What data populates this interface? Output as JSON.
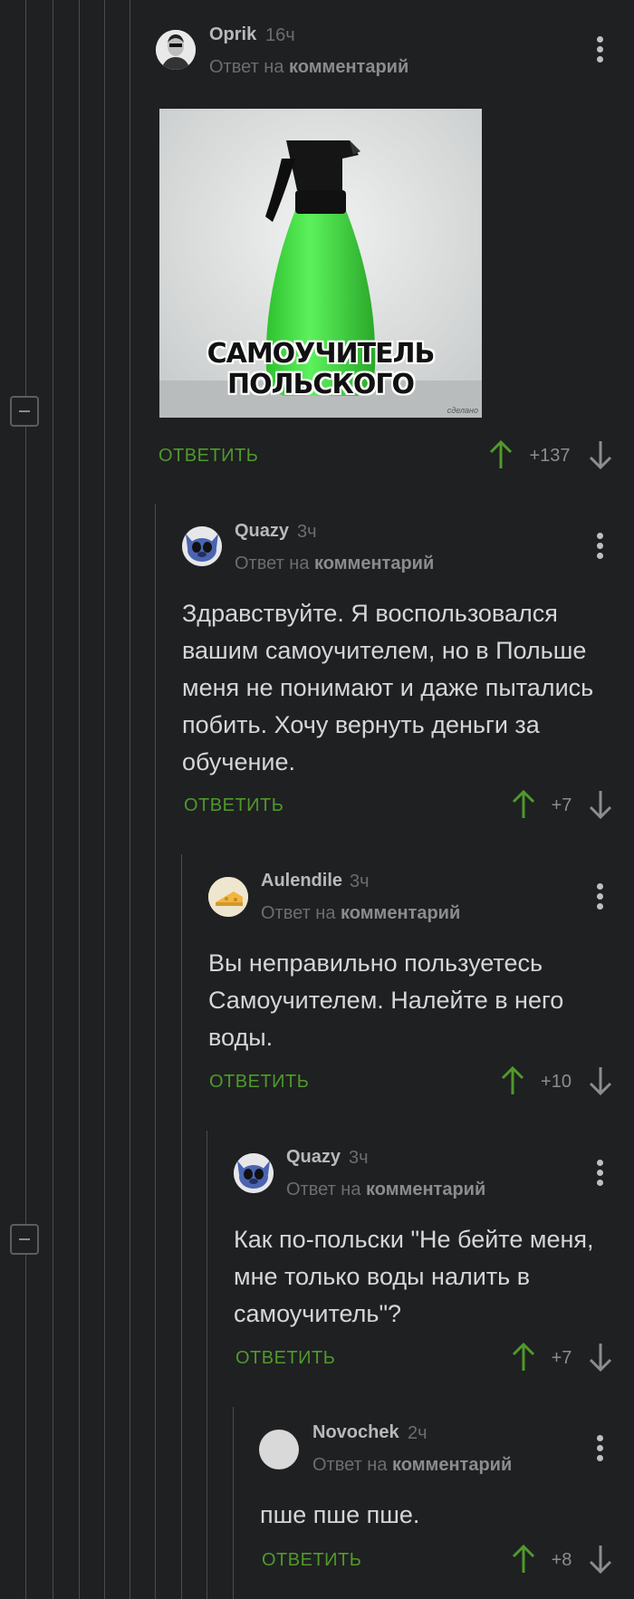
{
  "reply_prefix": "Ответ на",
  "reply_target": "комментарий",
  "reply_label": "ОТВЕТИТЬ",
  "icons": {
    "upvote": "arrow-up-icon",
    "downvote": "arrow-down-icon",
    "menu": "more-vertical-icon",
    "collapse": "minus-square-icon"
  },
  "colors": {
    "background": "#1f2022",
    "accent_green": "#4f9a2a",
    "text": "#d6d6d6",
    "muted": "#6c6d70"
  },
  "comments": [
    {
      "username": "Oprik",
      "time": "16ч",
      "image": {
        "caption_line1": "САМОУЧИТЕЛЬ",
        "caption_line2": "ПОЛЬСКОГО"
      },
      "score": "+137"
    },
    {
      "username": "Quazy",
      "time": "3ч",
      "text": "Здравствуйте. Я воспользовался вашим самоучителем, но в Польше меня не понимают и даже пытались побить. Хочу вернуть деньги за обучение.",
      "score": "+7"
    },
    {
      "username": "Aulendile",
      "time": "3ч",
      "text": "Вы неправильно пользуетесь Самоучителем. Налейте в него воды.",
      "score": "+10"
    },
    {
      "username": "Quazy",
      "time": "3ч",
      "text": "Как по-польски \"Не бейте меня, мне только воды налить в самоучитель\"?",
      "score": "+7"
    },
    {
      "username": "Novochek",
      "time": "2ч",
      "text": "пше пше пше.",
      "score": "+8"
    }
  ]
}
